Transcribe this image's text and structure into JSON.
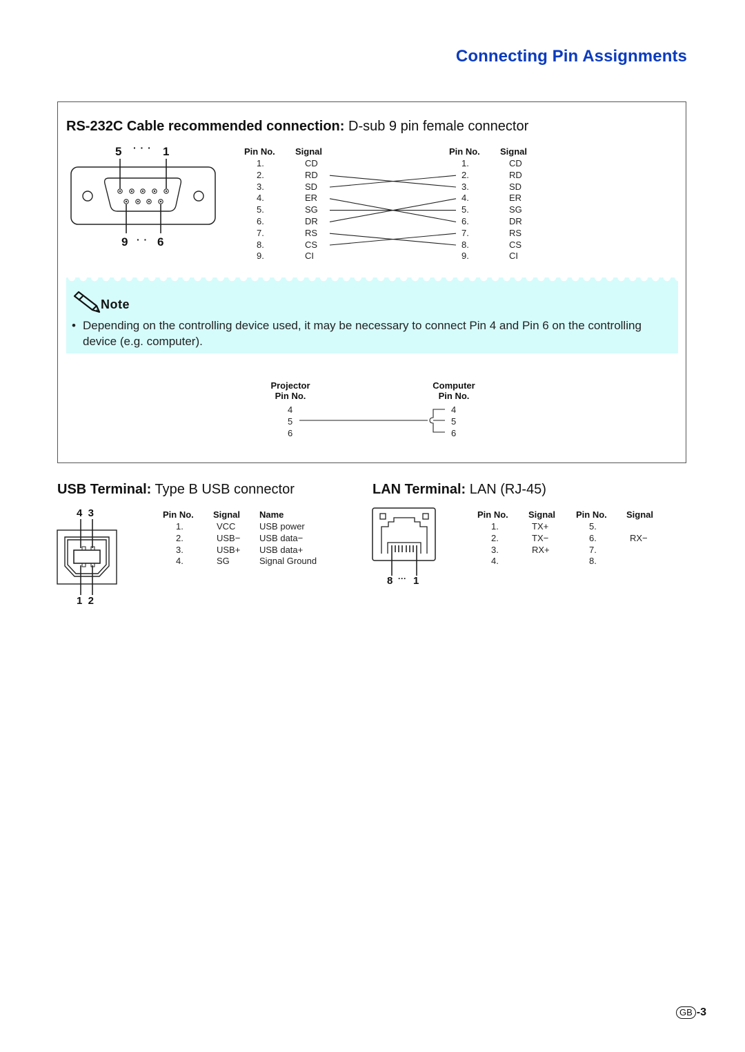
{
  "page": {
    "title": "Connecting Pin Assignments",
    "page_number_badge": "GB",
    "page_number": "-3"
  },
  "rs232": {
    "heading_bold": "RS-232C Cable recommended connection:",
    "heading_normal": " D-sub 9 pin female connector",
    "connector_labels": {
      "top_left": "5",
      "top_dots": "· · ·",
      "top_right": "1",
      "bottom_left": "9",
      "bottom_dots": "· ·",
      "bottom_right": "6"
    },
    "left_table": {
      "headers": [
        "Pin No.",
        "Signal"
      ],
      "rows": [
        [
          "1.",
          "CD"
        ],
        [
          "2.",
          "RD"
        ],
        [
          "3.",
          "SD"
        ],
        [
          "4.",
          "ER"
        ],
        [
          "5.",
          "SG"
        ],
        [
          "6.",
          "DR"
        ],
        [
          "7.",
          "RS"
        ],
        [
          "8.",
          "CS"
        ],
        [
          "9.",
          "CI"
        ]
      ]
    },
    "right_table": {
      "headers": [
        "Pin No.",
        "Signal"
      ],
      "rows": [
        [
          "1.",
          "CD"
        ],
        [
          "2.",
          "RD"
        ],
        [
          "3.",
          "SD"
        ],
        [
          "4.",
          "ER"
        ],
        [
          "5.",
          "SG"
        ],
        [
          "6.",
          "DR"
        ],
        [
          "7.",
          "RS"
        ],
        [
          "8.",
          "CS"
        ],
        [
          "9.",
          "CI"
        ]
      ]
    },
    "wiring": [
      [
        2,
        3
      ],
      [
        3,
        2
      ],
      [
        4,
        6
      ],
      [
        5,
        5
      ],
      [
        6,
        4
      ],
      [
        7,
        8
      ],
      [
        8,
        7
      ]
    ]
  },
  "note": {
    "title": "Note",
    "bullet": "•",
    "text": "Depending on the controlling device used, it may be necessary to connect Pin 4 and Pin 6 on the controlling device (e.g. computer)."
  },
  "loopback": {
    "left_header": [
      "Projector",
      "Pin No."
    ],
    "right_header": [
      "Computer",
      "Pin No."
    ],
    "left_pins": [
      "4",
      "5",
      "6"
    ],
    "right_pins": [
      "4",
      "5",
      "6"
    ]
  },
  "usb": {
    "heading_bold": "USB Terminal:",
    "heading_normal": " Type B USB connector",
    "pin_labels": {
      "top": "4  3",
      "bottom": "1  2"
    },
    "headers": [
      "Pin No.",
      "Signal",
      "Name"
    ],
    "rows": [
      [
        "1.",
        "VCC",
        "USB power"
      ],
      [
        "2.",
        "USB−",
        "USB data−"
      ],
      [
        "3.",
        "USB+",
        "USB data+"
      ],
      [
        "4.",
        "SG",
        "Signal Ground"
      ]
    ]
  },
  "lan": {
    "heading_bold": "LAN Terminal:",
    "heading_normal": " LAN (RJ-45)",
    "pin_labels": {
      "left": "8",
      "dots": "···",
      "right": "1"
    },
    "headers": [
      "Pin No.",
      "Signal",
      "Pin No.",
      "Signal"
    ],
    "rows": [
      [
        "1.",
        "TX+",
        "5.",
        ""
      ],
      [
        "2.",
        "TX−",
        "6.",
        "RX−"
      ],
      [
        "3.",
        "RX+",
        "7.",
        ""
      ],
      [
        "4.",
        "",
        "8.",
        ""
      ]
    ]
  }
}
